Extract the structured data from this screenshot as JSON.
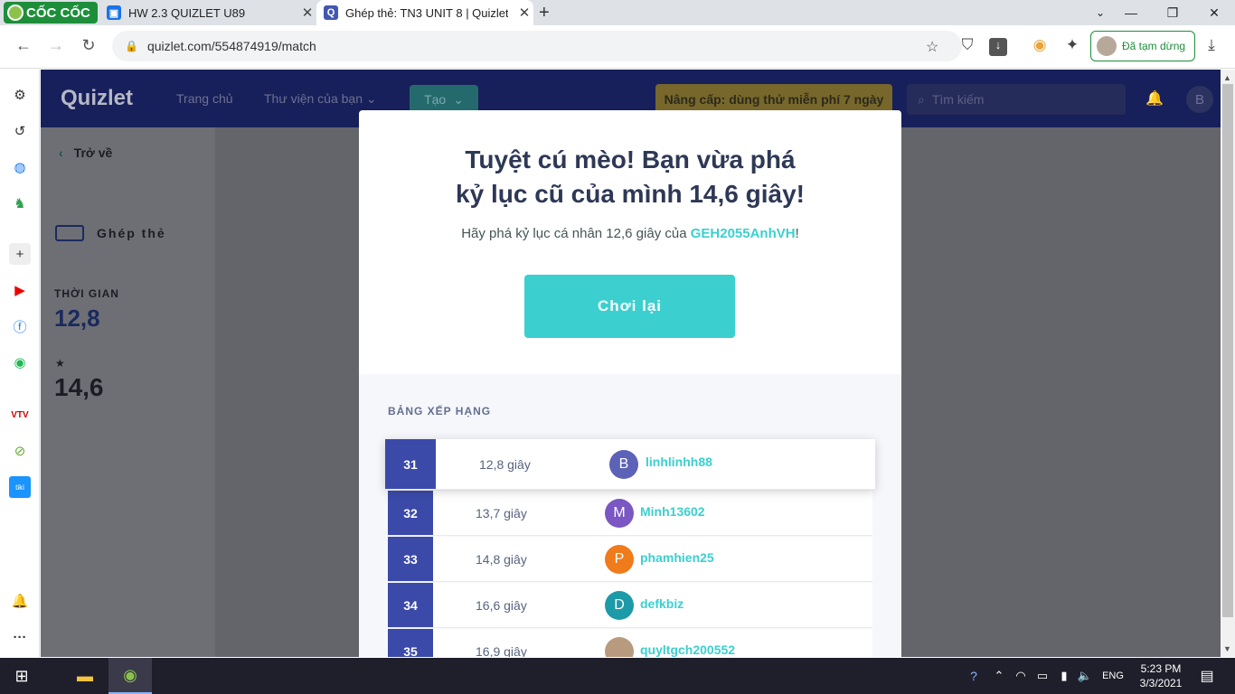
{
  "browser": {
    "brand": "CỐC CỐC",
    "tabs": [
      {
        "title": "HW 2.3 QUIZLET U89",
        "favicon": "Q",
        "color": "#1a73e8"
      },
      {
        "title": "Ghép thẻ: TN3 UNIT 8 | Quizlet",
        "favicon": "Q",
        "color": "#4257b2"
      }
    ],
    "close_glyph": "✕",
    "new_tab_glyph": "+",
    "url": "quizlet.com/554874919/match",
    "paused_label": "Đã tạm dừng",
    "window_controls": {
      "minimize": "—",
      "restore": "❐",
      "close": "✕"
    }
  },
  "quizlet_nav": {
    "logo": "Quizlet",
    "home": "Trang chủ",
    "library": "Thư viện của bạn",
    "create": "Tạo",
    "upgrade": "Nâng cấp: dùng thử miễn phí 7 ngày",
    "search_placeholder": "Tìm kiếm",
    "avatar_letter": "B"
  },
  "left_panel": {
    "back": "Trở về",
    "mode": "Ghép thẻ",
    "time_label": "THỜI GIAN",
    "time_value": "12,8",
    "star": "★",
    "best_value": "14,6"
  },
  "modal": {
    "title_line1": "Tuyệt cú mèo! Bạn vừa phá",
    "title_line2": "kỷ lục cũ của mình 14,6 giây!",
    "subtitle_prefix": "Hãy phá kỷ lục cá nhân 12,6 giây của",
    "subtitle_user": "GEH2055AnhVH",
    "subtitle_suffix": "!",
    "play_again": "Chơi lại",
    "leaderboard_title": "BẢNG XẾP HẠNG",
    "leaderboard": [
      {
        "rank": "31",
        "time": "12,8 giây",
        "initial": "B",
        "user": "linhlinhh88",
        "color": "#5b62b8"
      },
      {
        "rank": "32",
        "time": "13,7 giây",
        "initial": "M",
        "user": "Minh13602",
        "color": "#7a57c2"
      },
      {
        "rank": "33",
        "time": "14,8 giây",
        "initial": "P",
        "user": "phamhien25",
        "color": "#f07b1a"
      },
      {
        "rank": "34",
        "time": "16,6 giây",
        "initial": "D",
        "user": "defkbiz",
        "color": "#1c9aa8"
      },
      {
        "rank": "35",
        "time": "16,9 giây",
        "initial": "",
        "user": "quyltgch200552",
        "color": "#b89a7e"
      }
    ]
  },
  "taskbar": {
    "lang": "ENG",
    "time": "5:23 PM",
    "date": "3/3/2021"
  }
}
